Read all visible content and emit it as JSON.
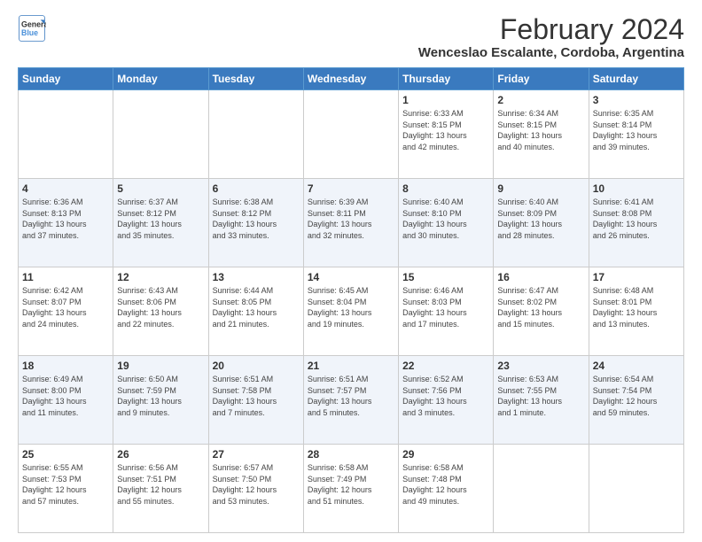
{
  "logo": {
    "line1": "General",
    "line2": "Blue"
  },
  "title": "February 2024",
  "subtitle": "Wenceslao Escalante, Cordoba, Argentina",
  "days_of_week": [
    "Sunday",
    "Monday",
    "Tuesday",
    "Wednesday",
    "Thursday",
    "Friday",
    "Saturday"
  ],
  "weeks": [
    [
      {
        "day": "",
        "info": ""
      },
      {
        "day": "",
        "info": ""
      },
      {
        "day": "",
        "info": ""
      },
      {
        "day": "",
        "info": ""
      },
      {
        "day": "1",
        "info": "Sunrise: 6:33 AM\nSunset: 8:15 PM\nDaylight: 13 hours\nand 42 minutes."
      },
      {
        "day": "2",
        "info": "Sunrise: 6:34 AM\nSunset: 8:15 PM\nDaylight: 13 hours\nand 40 minutes."
      },
      {
        "day": "3",
        "info": "Sunrise: 6:35 AM\nSunset: 8:14 PM\nDaylight: 13 hours\nand 39 minutes."
      }
    ],
    [
      {
        "day": "4",
        "info": "Sunrise: 6:36 AM\nSunset: 8:13 PM\nDaylight: 13 hours\nand 37 minutes."
      },
      {
        "day": "5",
        "info": "Sunrise: 6:37 AM\nSunset: 8:12 PM\nDaylight: 13 hours\nand 35 minutes."
      },
      {
        "day": "6",
        "info": "Sunrise: 6:38 AM\nSunset: 8:12 PM\nDaylight: 13 hours\nand 33 minutes."
      },
      {
        "day": "7",
        "info": "Sunrise: 6:39 AM\nSunset: 8:11 PM\nDaylight: 13 hours\nand 32 minutes."
      },
      {
        "day": "8",
        "info": "Sunrise: 6:40 AM\nSunset: 8:10 PM\nDaylight: 13 hours\nand 30 minutes."
      },
      {
        "day": "9",
        "info": "Sunrise: 6:40 AM\nSunset: 8:09 PM\nDaylight: 13 hours\nand 28 minutes."
      },
      {
        "day": "10",
        "info": "Sunrise: 6:41 AM\nSunset: 8:08 PM\nDaylight: 13 hours\nand 26 minutes."
      }
    ],
    [
      {
        "day": "11",
        "info": "Sunrise: 6:42 AM\nSunset: 8:07 PM\nDaylight: 13 hours\nand 24 minutes."
      },
      {
        "day": "12",
        "info": "Sunrise: 6:43 AM\nSunset: 8:06 PM\nDaylight: 13 hours\nand 22 minutes."
      },
      {
        "day": "13",
        "info": "Sunrise: 6:44 AM\nSunset: 8:05 PM\nDaylight: 13 hours\nand 21 minutes."
      },
      {
        "day": "14",
        "info": "Sunrise: 6:45 AM\nSunset: 8:04 PM\nDaylight: 13 hours\nand 19 minutes."
      },
      {
        "day": "15",
        "info": "Sunrise: 6:46 AM\nSunset: 8:03 PM\nDaylight: 13 hours\nand 17 minutes."
      },
      {
        "day": "16",
        "info": "Sunrise: 6:47 AM\nSunset: 8:02 PM\nDaylight: 13 hours\nand 15 minutes."
      },
      {
        "day": "17",
        "info": "Sunrise: 6:48 AM\nSunset: 8:01 PM\nDaylight: 13 hours\nand 13 minutes."
      }
    ],
    [
      {
        "day": "18",
        "info": "Sunrise: 6:49 AM\nSunset: 8:00 PM\nDaylight: 13 hours\nand 11 minutes."
      },
      {
        "day": "19",
        "info": "Sunrise: 6:50 AM\nSunset: 7:59 PM\nDaylight: 13 hours\nand 9 minutes."
      },
      {
        "day": "20",
        "info": "Sunrise: 6:51 AM\nSunset: 7:58 PM\nDaylight: 13 hours\nand 7 minutes."
      },
      {
        "day": "21",
        "info": "Sunrise: 6:51 AM\nSunset: 7:57 PM\nDaylight: 13 hours\nand 5 minutes."
      },
      {
        "day": "22",
        "info": "Sunrise: 6:52 AM\nSunset: 7:56 PM\nDaylight: 13 hours\nand 3 minutes."
      },
      {
        "day": "23",
        "info": "Sunrise: 6:53 AM\nSunset: 7:55 PM\nDaylight: 13 hours\nand 1 minute."
      },
      {
        "day": "24",
        "info": "Sunrise: 6:54 AM\nSunset: 7:54 PM\nDaylight: 12 hours\nand 59 minutes."
      }
    ],
    [
      {
        "day": "25",
        "info": "Sunrise: 6:55 AM\nSunset: 7:53 PM\nDaylight: 12 hours\nand 57 minutes."
      },
      {
        "day": "26",
        "info": "Sunrise: 6:56 AM\nSunset: 7:51 PM\nDaylight: 12 hours\nand 55 minutes."
      },
      {
        "day": "27",
        "info": "Sunrise: 6:57 AM\nSunset: 7:50 PM\nDaylight: 12 hours\nand 53 minutes."
      },
      {
        "day": "28",
        "info": "Sunrise: 6:58 AM\nSunset: 7:49 PM\nDaylight: 12 hours\nand 51 minutes."
      },
      {
        "day": "29",
        "info": "Sunrise: 6:58 AM\nSunset: 7:48 PM\nDaylight: 12 hours\nand 49 minutes."
      },
      {
        "day": "",
        "info": ""
      },
      {
        "day": "",
        "info": ""
      }
    ]
  ]
}
